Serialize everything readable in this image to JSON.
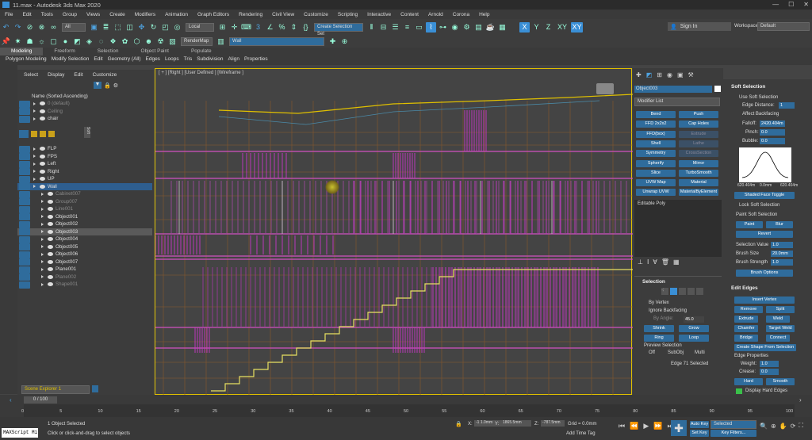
{
  "window": {
    "title": "11.max - Autodesk 3ds Max 2020"
  },
  "menu": [
    "File",
    "Edit",
    "Tools",
    "Group",
    "Views",
    "Create",
    "Modifiers",
    "Animation",
    "Graph Editors",
    "Rendering",
    "Civil View",
    "Customize",
    "Scripting",
    "Interactive",
    "Content",
    "Arnold",
    "Corona",
    "Help"
  ],
  "account": {
    "signin": "Sign In",
    "workspaces_label": "Workspaces:",
    "workspace": "Default"
  },
  "toolbar": {
    "filter": "All",
    "ref_coord": "Local",
    "selset": "Create Selection Set",
    "view_x": "X",
    "view_y": "Y",
    "view_z": "Z",
    "view_xy": "XY",
    "view_xy2": "XY",
    "rendermap": "RenderMap",
    "layer": "Wall"
  },
  "ribbon": {
    "tabs": [
      "Modeling",
      "Freeform",
      "Selection",
      "Object Paint",
      "Populate"
    ],
    "items": [
      "Polygon Modeling",
      "Modify Selection",
      "Edit",
      "Geometry (All)",
      "Edges",
      "Loops",
      "Tris",
      "Subdivision",
      "Align",
      "Properties"
    ]
  },
  "scene_explorer": {
    "menu": [
      "Select",
      "Display",
      "Edit",
      "Customize"
    ],
    "column": "Name (Sorted Ascending)",
    "items": [
      {
        "name": "0 (default)",
        "dim": true
      },
      {
        "name": "Ceiling",
        "dim": true
      },
      {
        "name": "chair",
        "dim": false
      },
      {
        "name": "FLP",
        "dim": false
      },
      {
        "name": "FPS",
        "dim": false
      },
      {
        "name": "Left",
        "dim": false
      },
      {
        "name": "Right",
        "dim": false
      },
      {
        "name": "UP",
        "dim": false
      },
      {
        "name": "Wall",
        "dim": false,
        "selected": true
      },
      {
        "name": "Cabinet007",
        "dim": true
      },
      {
        "name": "Group007",
        "dim": true
      },
      {
        "name": "Line001",
        "dim": true
      },
      {
        "name": "Object001",
        "dim": false
      },
      {
        "name": "Object002",
        "dim": false
      },
      {
        "name": "Object003",
        "dim": false,
        "hl": true
      },
      {
        "name": "Object004",
        "dim": false
      },
      {
        "name": "Object005",
        "dim": false
      },
      {
        "name": "Object006",
        "dim": false
      },
      {
        "name": "Object007",
        "dim": false
      },
      {
        "name": "Plane001",
        "dim": false
      },
      {
        "name": "Plane002",
        "dim": true
      },
      {
        "name": "Shape001",
        "dim": true
      }
    ],
    "footer": "Scene Explorer 1",
    "soft_tab": "Soft"
  },
  "viewport": {
    "label": "[ + ] [Right ] [User Defined ] [Wireframe ]"
  },
  "command_panel": {
    "object_name": "Object003",
    "modifier_list": "Modifier List",
    "buttons": [
      "Bend",
      "Push",
      "FFD 2x2x2",
      "Cap Holes",
      "FFD(box)",
      "Extrude",
      "Shell",
      "Lathe",
      "Symmetry",
      "CrossSection",
      "Spherify",
      "Mirror",
      "Slice",
      "TurboSmooth",
      "UVW Map",
      "Material",
      "Unwrap UVW",
      "MaterialByElement"
    ],
    "stack_item": "Editable Poly",
    "selection": {
      "title": "Selection",
      "by_vertex": "By Vertex",
      "ignore_backfacing": "Ignore Backfacing",
      "by_angle": "By Angle:",
      "by_angle_val": "45.0",
      "shrink": "Shrink",
      "grow": "Grow",
      "ring": "Ring",
      "loop": "Loop",
      "preview": "Preview Selection",
      "off": "Off",
      "subobj": "SubObj",
      "multi": "Multi",
      "status": "Edge 71 Selected"
    }
  },
  "soft_selection": {
    "title": "Soft Selection",
    "use": "Use Soft Selection",
    "edge_distance": "Edge Distance:",
    "edge_distance_val": "1",
    "affect_backfacing": "Affect Backfacing",
    "falloff": "Falloff:",
    "falloff_val": "2420.404m",
    "pinch": "Pinch:",
    "pinch_val": "0.0",
    "bubble": "Bubble:",
    "bubble_val": "0.0",
    "curve_left": "620.404m",
    "curve_mid": "0.0mm",
    "curve_right": "620.404m",
    "shaded": "Shaded Face Toggle",
    "lock": "Lock Soft Selection",
    "paint_title": "Paint Soft Selection",
    "paint": "Paint",
    "blur": "Blur",
    "revert": "Revert",
    "sel_value": "Selection Value",
    "sel_value_val": "1.0",
    "brush_size": "Brush Size",
    "brush_size_val": "20.0mm",
    "brush_strength": "Brush Strength",
    "brush_strength_val": "1.0",
    "brush_options": "Brush Options"
  },
  "edit_edges": {
    "title": "Edit Edges",
    "insert_vertex": "Insert Vertex",
    "remove": "Remove",
    "split": "Split",
    "extrude": "Extrude",
    "weld": "Weld",
    "chamfer": "Chamfer",
    "target_weld": "Target Weld",
    "bridge": "Bridge",
    "connect": "Connect",
    "create_shape": "Create Shape From Selection",
    "props": "Edge Properties",
    "weight": "Weight:",
    "weight_val": "1.0",
    "crease": "Crease:",
    "crease_val": "0.0",
    "hard": "Hard",
    "smooth": "Smooth",
    "display_hard": "Display Hard Edges"
  },
  "timeline": {
    "frame": "0 / 100",
    "ticks": [
      "0",
      "5",
      "10",
      "15",
      "20",
      "25",
      "30",
      "35",
      "40",
      "45",
      "50",
      "55",
      "60",
      "65",
      "70",
      "75",
      "80",
      "85",
      "90",
      "95",
      "100"
    ]
  },
  "status": {
    "maxscript": "MAXScript Mi",
    "selected": "1 Object Selected",
    "prompt": "Click or click-and-drag to select objects",
    "x_label": "X:",
    "x": "-1 1.0mm",
    "y_label": "Y:",
    "y": "1865.5mm",
    "z_label": "Z:",
    "z": "-787.5mm",
    "grid": "Grid = 0.0mm",
    "addtimetag": "Add Time Tag",
    "autokey": "Auto Key",
    "setkey": "Set Key",
    "selected_dd": "Selected",
    "keyfilters": "Key Filters..."
  }
}
